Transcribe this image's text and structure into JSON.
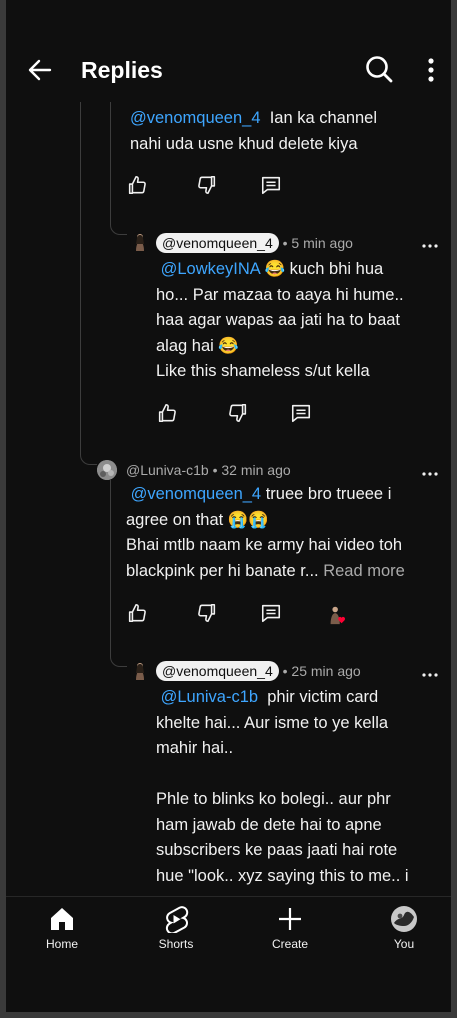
{
  "header": {
    "title": "Replies"
  },
  "thread": {
    "top_comment": {
      "mention": "@venomqueen_4",
      "text_line1_rest": "Ian ka channel",
      "text_line2": "nahi uda usne khud delete kiya"
    },
    "reply1": {
      "author": "@venomqueen_4",
      "time": "• 5 min ago",
      "mention": "@LowkeyINA",
      "line1_rest": "😂 kuch bhi hua",
      "line2": "ho... Par mazaa to aaya hi hume..",
      "line3": "haa agar wapas aa jati ha to baat",
      "line4": "alag hai 😂",
      "line5": "Like this shameless s/ut kella"
    },
    "comment2": {
      "author": "@Luniva-c1b",
      "time": "• 32 min ago",
      "mention": "@venomqueen_4",
      "line1_rest": "truee bro trueee i",
      "line2": "agree on that 😭😭",
      "line3": "Bhai mtlb naam ke army hai video toh",
      "line4": "blackpink per hi banate r...",
      "read_more": "Read more"
    },
    "reply2": {
      "author": "@venomqueen_4",
      "time": "• 25 min ago",
      "mention": "@Luniva-c1b",
      "line1_rest": "phir victim card",
      "line2": "khelte hai... Aur isme to ye kella",
      "line3": "mahir hai..",
      "line4": "Phle to blinks ko bolegi.. aur phr",
      "line5": "ham jawab de dete hai to apne",
      "line6": "subscribers ke paas jaati hai rote",
      "line7": "hue \"look.. xyz saying this to me.. i"
    }
  },
  "nav": {
    "home": "Home",
    "shorts": "Shorts",
    "create": "Create",
    "you": "You"
  },
  "colors": {
    "background": "#0f0f0f",
    "text": "#f1f1f1",
    "mention": "#3ea6ff",
    "muted": "#aaaaaa"
  }
}
